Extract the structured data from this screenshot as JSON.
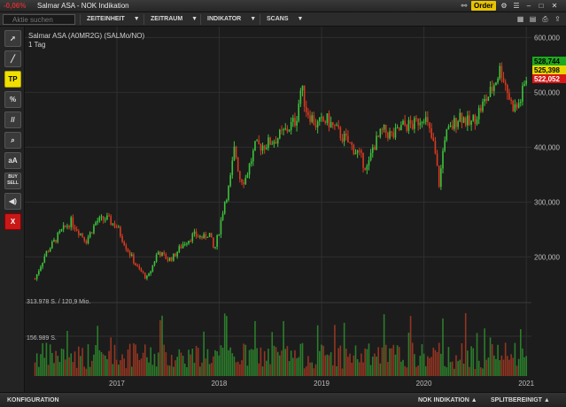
{
  "window": {
    "change_pct": "-0,06%",
    "title": "Salmar ASA - NOK Indikation",
    "order_label": "Order"
  },
  "toolbar": {
    "search_placeholder": "Aktie suchen",
    "menus": [
      "ZEITEINHEIT",
      "ZEITRAUM",
      "INDIKATOR",
      "SCANS"
    ]
  },
  "tools": [
    {
      "label": "",
      "icon": "cursor-crosshair-icon"
    },
    {
      "label": "",
      "icon": "line-draw-icon"
    },
    {
      "label": "TP",
      "icon": "target-price-icon"
    },
    {
      "label": "%",
      "icon": "percent-icon"
    },
    {
      "label": "//",
      "icon": "parallel-lines-icon"
    },
    {
      "label": "",
      "icon": "zoom-icon"
    },
    {
      "label": "aA",
      "icon": "text-icon"
    },
    {
      "label": "BUY SELL",
      "icon": "buy-sell-icon"
    },
    {
      "label": "",
      "icon": "speaker-icon"
    },
    {
      "label": "X",
      "icon": "delete-icon"
    }
  ],
  "chart": {
    "title": "Salmar ASA (A0MR2G) (SALMo/NO)",
    "period": "1 Tag",
    "volume_label_high": "313.978 S. / 120,9 Mio.",
    "volume_label_mid": "156.989 S.",
    "price_badges": [
      {
        "text": "528,744",
        "bg": "#1ea81e",
        "fg": "#000000"
      },
      {
        "text": "525,398",
        "bg": "#e8d800",
        "fg": "#000000"
      },
      {
        "text": "522,052",
        "bg": "#d81818",
        "fg": "#ffffff"
      }
    ],
    "up_color": "#3cc23c",
    "down_color": "#d83a20"
  },
  "chart_data": {
    "type": "line",
    "title": "Salmar ASA (A0MR2G) (SALMo/NO)",
    "subtitle": "1 Tag",
    "xlabel": "",
    "ylabel": "",
    "x_ticks": [
      "2017",
      "2018",
      "2019",
      "2020",
      "2021"
    ],
    "y_ticks": [
      200000,
      300000,
      400000,
      500000,
      600000
    ],
    "y_tick_labels": [
      "200,000",
      "300,000",
      "400,000",
      "500,000",
      "600,000"
    ],
    "ylim": [
      120000,
      620000
    ],
    "x": [
      2016.2,
      2016.3,
      2016.45,
      2016.55,
      2016.7,
      2016.8,
      2016.9,
      2017.0,
      2017.1,
      2017.2,
      2017.3,
      2017.4,
      2017.5,
      2017.55,
      2017.65,
      2017.75,
      2017.85,
      2017.9,
      2017.95,
      2018.0,
      2018.05,
      2018.1,
      2018.15,
      2018.2,
      2018.25,
      2018.3,
      2018.35,
      2018.45,
      2018.55,
      2018.65,
      2018.75,
      2018.8,
      2018.85,
      2018.95,
      2019.05,
      2019.15,
      2019.25,
      2019.35,
      2019.45,
      2019.5,
      2019.6,
      2019.7,
      2019.8,
      2019.9,
      2020.0,
      2020.1,
      2020.15,
      2020.2,
      2020.25,
      2020.35,
      2020.45,
      2020.55,
      2020.65,
      2020.75,
      2020.85,
      2020.9,
      2020.95,
      2021.0
    ],
    "series": [
      {
        "values": [
          160000,
          205000,
          245000,
          265000,
          230000,
          265000,
          270000,
          255000,
          215000,
          180000,
          160000,
          210000,
          195000,
          200000,
          225000,
          240000,
          235000,
          245000,
          210000,
          250000,
          300000,
          330000,
          400000,
          345000,
          340000,
          370000,
          400000,
          405000,
          415000,
          430000,
          450000,
          510000,
          470000,
          440000,
          450000,
          430000,
          410000,
          390000,
          360000,
          400000,
          430000,
          420000,
          440000,
          440000,
          460000,
          400000,
          330000,
          420000,
          430000,
          460000,
          440000,
          470000,
          500000,
          545000,
          480000,
          470000,
          490000,
          525398
        ]
      }
    ],
    "volume_ticks": [
      "313.978 S. / 120,9 Mio.",
      "156.989 S."
    ],
    "grid": true
  }
}
